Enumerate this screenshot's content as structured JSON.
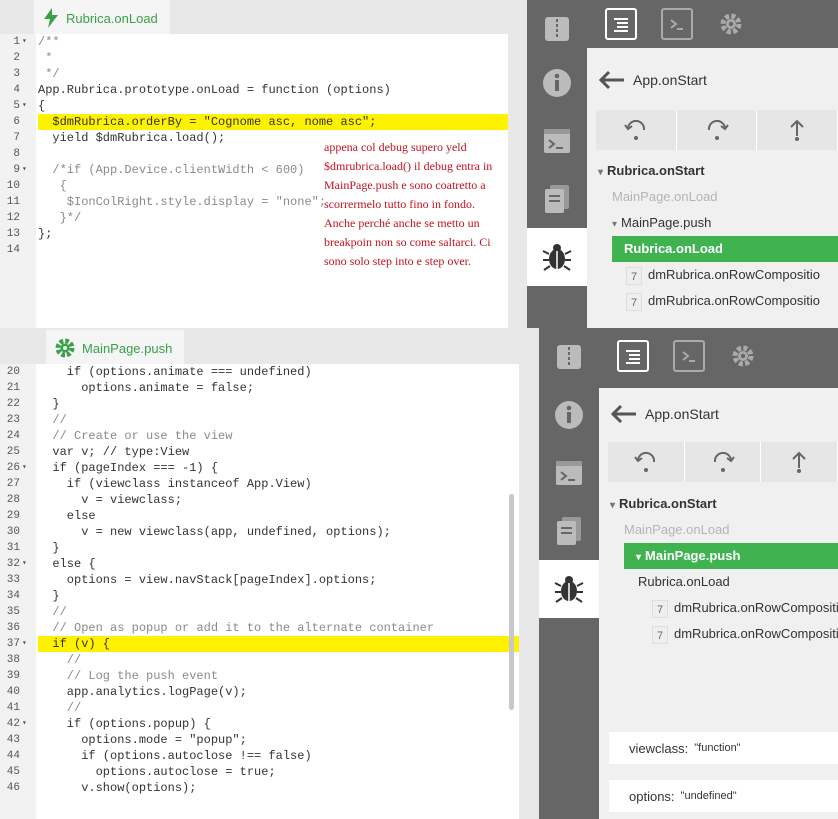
{
  "top": {
    "tab": {
      "title": "Rubrica.onLoad"
    },
    "lines": [
      {
        "n": "1",
        "fold": "▾",
        "t": "/**",
        "cls": "cm"
      },
      {
        "n": "2",
        "fold": "",
        "t": " *",
        "cls": "cm"
      },
      {
        "n": "3",
        "fold": "",
        "t": " */",
        "cls": "cm"
      },
      {
        "n": "4",
        "fold": "",
        "t": "App.Rubrica.prototype.onLoad = function (options)",
        "cls": ""
      },
      {
        "n": "5",
        "fold": "▾",
        "t": "{",
        "cls": ""
      },
      {
        "n": "6",
        "fold": "",
        "t": "  $dmRubrica.orderBy = \"Cognome asc, nome asc\";",
        "cls": "",
        "hl": true
      },
      {
        "n": "7",
        "fold": "",
        "t": "  yield $dmRubrica.load();",
        "cls": ""
      },
      {
        "n": "8",
        "fold": "",
        "t": "",
        "cls": ""
      },
      {
        "n": "9",
        "fold": "▾",
        "t": "  /*if (App.Device.clientWidth < 600)",
        "cls": "cm"
      },
      {
        "n": "10",
        "fold": "",
        "t": "   {",
        "cls": "cm"
      },
      {
        "n": "11",
        "fold": "",
        "t": "    $IonColRight.style.display = \"none\";",
        "cls": "cm"
      },
      {
        "n": "12",
        "fold": "",
        "t": "   }*/",
        "cls": "cm"
      },
      {
        "n": "13",
        "fold": "",
        "t": "};",
        "cls": ""
      },
      {
        "n": "14",
        "fold": "",
        "t": "",
        "cls": ""
      }
    ],
    "note": "appena col debug supero yeld $dmrubrica.load() il debug entra in MainPage.push e sono coatretto a scorrermelo tutto fino in fondo. Anche perché anche se metto un breakpoin non so come saltarci. Ci sono solo step into e step over.",
    "debugger": {
      "back_label": "App.onStart",
      "tree": [
        {
          "label": "Rubrica.onStart",
          "state": "bold",
          "indent": 0,
          "arrow": "▾"
        },
        {
          "label": "MainPage.onLoad",
          "state": "dim",
          "indent": 1,
          "arrow": ""
        },
        {
          "label": "MainPage.push",
          "state": "normal",
          "indent": 1,
          "arrow": "▾"
        },
        {
          "label": "Rubrica.onLoad",
          "state": "sel",
          "indent": 1,
          "arrow": ""
        },
        {
          "label": "dmRubrica.onRowCompositio",
          "state": "normal",
          "indent": 2,
          "arrow": "",
          "badge": "7"
        },
        {
          "label": "dmRubrica.onRowCompositio",
          "state": "normal",
          "indent": 2,
          "arrow": "",
          "badge": "7"
        }
      ]
    }
  },
  "bottom": {
    "tab": {
      "title": "MainPage.push"
    },
    "lines": [
      {
        "n": "20",
        "fold": "",
        "t": "    if (options.animate === undefined)",
        "cls": ""
      },
      {
        "n": "21",
        "fold": "",
        "t": "      options.animate = false;",
        "cls": ""
      },
      {
        "n": "22",
        "fold": "",
        "t": "  }",
        "cls": ""
      },
      {
        "n": "23",
        "fold": "",
        "t": "  //",
        "cls": "cm"
      },
      {
        "n": "24",
        "fold": "",
        "t": "  // Create or use the view",
        "cls": "cm"
      },
      {
        "n": "25",
        "fold": "",
        "t": "  var v; // type:View",
        "cls": ""
      },
      {
        "n": "26",
        "fold": "▾",
        "t": "  if (pageIndex === -1) {",
        "cls": ""
      },
      {
        "n": "27",
        "fold": "",
        "t": "    if (viewclass instanceof App.View)",
        "cls": ""
      },
      {
        "n": "28",
        "fold": "",
        "t": "      v = viewclass;",
        "cls": ""
      },
      {
        "n": "29",
        "fold": "",
        "t": "    else",
        "cls": ""
      },
      {
        "n": "30",
        "fold": "",
        "t": "      v = new viewclass(app, undefined, options);",
        "cls": ""
      },
      {
        "n": "31",
        "fold": "",
        "t": "  }",
        "cls": ""
      },
      {
        "n": "32",
        "fold": "▾",
        "t": "  else {",
        "cls": ""
      },
      {
        "n": "33",
        "fold": "",
        "t": "    options = view.navStack[pageIndex].options;",
        "cls": ""
      },
      {
        "n": "34",
        "fold": "",
        "t": "  }",
        "cls": ""
      },
      {
        "n": "35",
        "fold": "",
        "t": "  //",
        "cls": "cm"
      },
      {
        "n": "36",
        "fold": "",
        "t": "  // Open as popup or add it to the alternate container",
        "cls": "cm"
      },
      {
        "n": "37",
        "fold": "▾",
        "t": "  if (v) {",
        "cls": "",
        "hl": true
      },
      {
        "n": "38",
        "fold": "",
        "t": "    //",
        "cls": "cm"
      },
      {
        "n": "39",
        "fold": "",
        "t": "    // Log the push event",
        "cls": "cm"
      },
      {
        "n": "40",
        "fold": "",
        "t": "    app.analytics.logPage(v);",
        "cls": ""
      },
      {
        "n": "41",
        "fold": "",
        "t": "    //",
        "cls": "cm"
      },
      {
        "n": "42",
        "fold": "▾",
        "t": "    if (options.popup) {",
        "cls": ""
      },
      {
        "n": "43",
        "fold": "",
        "t": "      options.mode = \"popup\";",
        "cls": ""
      },
      {
        "n": "44",
        "fold": "",
        "t": "      if (options.autoclose !== false)",
        "cls": ""
      },
      {
        "n": "45",
        "fold": "",
        "t": "        options.autoclose = true;",
        "cls": ""
      },
      {
        "n": "46",
        "fold": "",
        "t": "      v.show(options);",
        "cls": ""
      }
    ],
    "debugger": {
      "back_label": "App.onStart",
      "tree": [
        {
          "label": "Rubrica.onStart",
          "state": "bold",
          "indent": 0,
          "arrow": "▾"
        },
        {
          "label": "MainPage.onLoad",
          "state": "dim",
          "indent": 1,
          "arrow": ""
        },
        {
          "label": "MainPage.push",
          "state": "sel",
          "indent": 1,
          "arrow": "▾"
        },
        {
          "label": "Rubrica.onLoad",
          "state": "normal",
          "indent": 2,
          "arrow": ""
        },
        {
          "label": "dmRubrica.onRowCompositio",
          "state": "normal",
          "indent": 3,
          "arrow": "",
          "badge": "7"
        },
        {
          "label": "dmRubrica.onRowCompositio",
          "state": "normal",
          "indent": 3,
          "arrow": "",
          "badge": "7"
        }
      ],
      "vars": [
        {
          "name": "viewclass:",
          "value": "\"function\""
        },
        {
          "name": "options:",
          "value": "\"undefined\""
        }
      ]
    }
  }
}
